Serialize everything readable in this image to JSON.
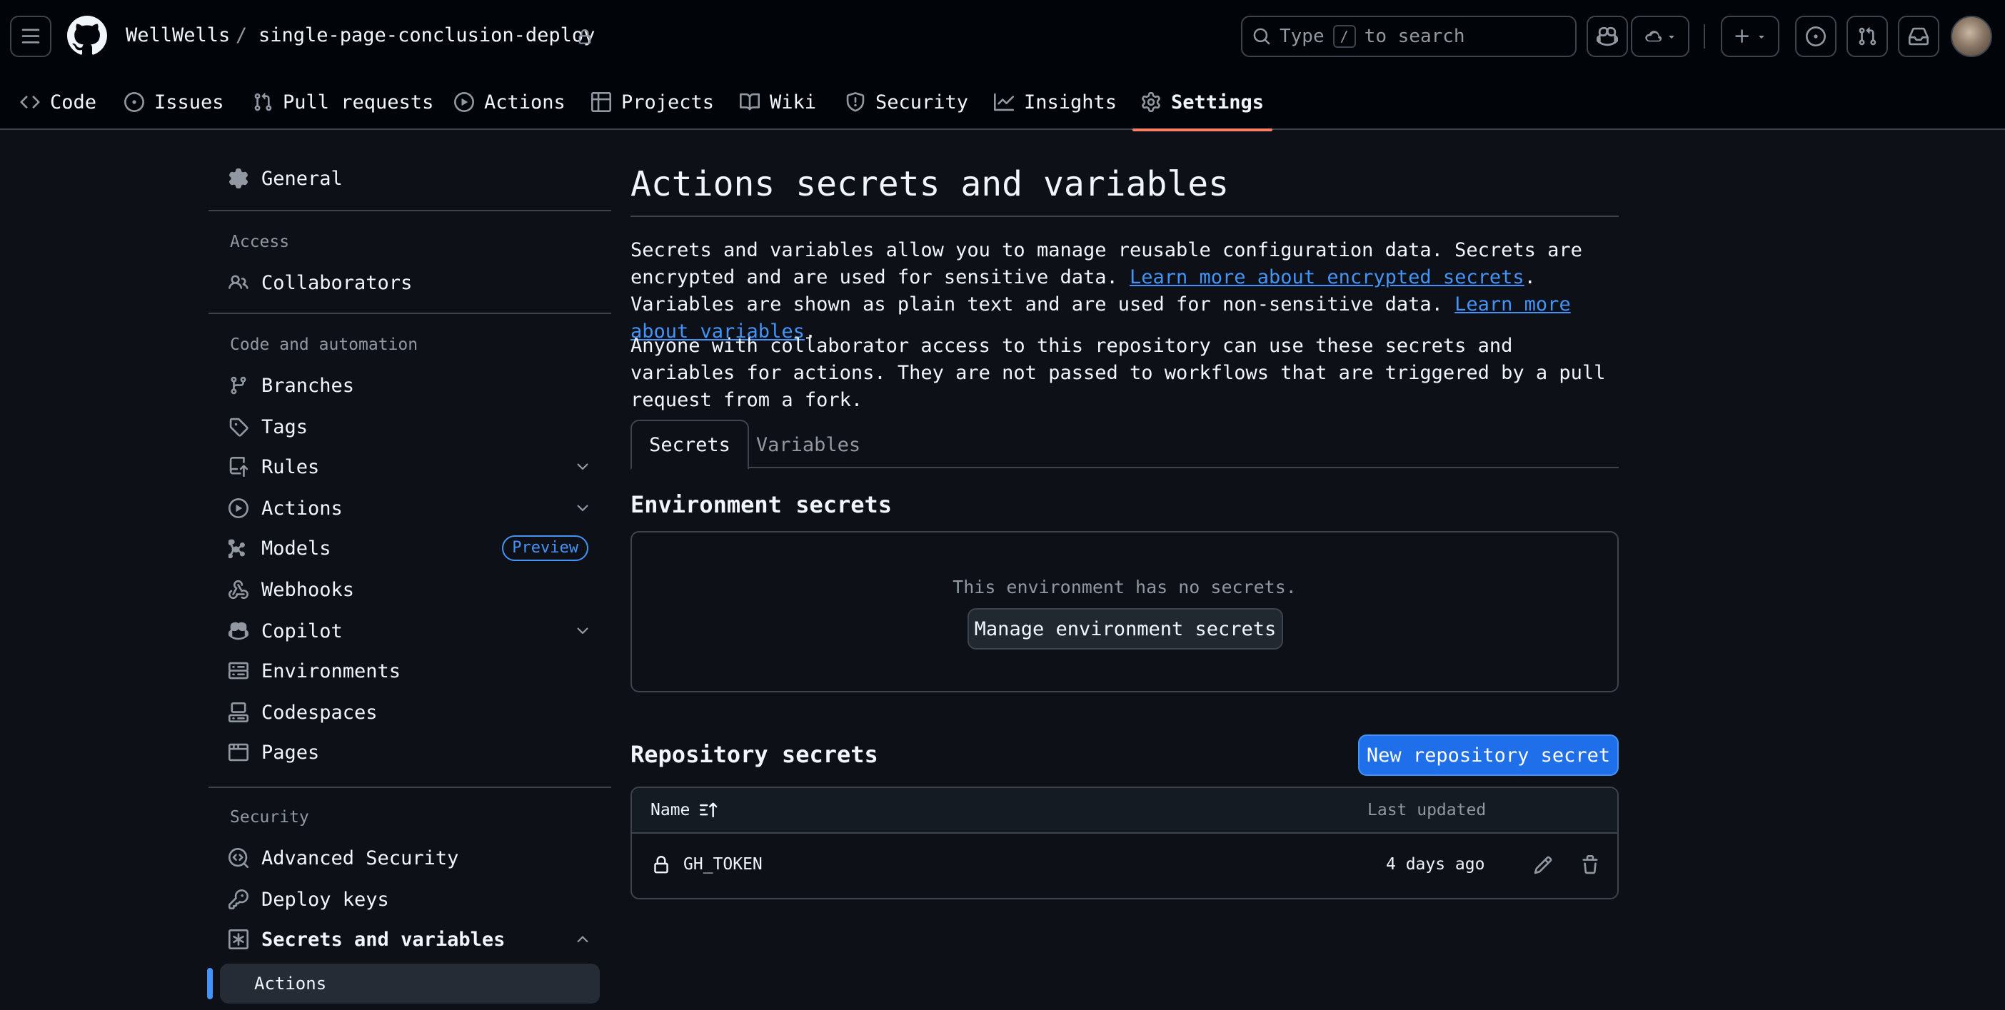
{
  "repo": {
    "owner": "WellWells",
    "separator": "/",
    "name": "single-page-conclusion-deploy"
  },
  "search": {
    "prefix": "Type",
    "key": "/",
    "suffix": "to search"
  },
  "tabs": [
    {
      "label": "Code",
      "icon": "code-icon"
    },
    {
      "label": "Issues",
      "icon": "issue-opened-icon"
    },
    {
      "label": "Pull requests",
      "icon": "git-pull-request-icon"
    },
    {
      "label": "Actions",
      "icon": "play-icon"
    },
    {
      "label": "Projects",
      "icon": "table-icon"
    },
    {
      "label": "Wiki",
      "icon": "book-icon"
    },
    {
      "label": "Security",
      "icon": "shield-icon"
    },
    {
      "label": "Insights",
      "icon": "graph-icon"
    },
    {
      "label": "Settings",
      "icon": "gear-icon",
      "selected": true
    }
  ],
  "sidebar": {
    "general": "General",
    "access_heading": "Access",
    "collaborators": "Collaborators",
    "code_heading": "Code and automation",
    "branches": "Branches",
    "tags": "Tags",
    "rules": "Rules",
    "actions": "Actions",
    "models": "Models",
    "models_badge": "Preview",
    "webhooks": "Webhooks",
    "copilot": "Copilot",
    "environments": "Environments",
    "codespaces": "Codespaces",
    "pages": "Pages",
    "security_heading": "Security",
    "advanced_security": "Advanced Security",
    "deploy_keys": "Deploy keys",
    "secrets_and_variables": "Secrets and variables",
    "secrets_actions": "Actions"
  },
  "main": {
    "title": "Actions secrets and variables",
    "intro_1": "Secrets and variables allow you to manage reusable configuration data. Secrets are encrypted and are used for sensitive data. ",
    "intro_link_1": "Learn more about encrypted secrets",
    "intro_2": ". Variables are shown as plain text and are used for non-sensitive data. ",
    "intro_link_2": "Learn more about variables",
    "intro_3": ".",
    "access_note": "Anyone with collaborator access to this repository can use these secrets and variables for actions. They are not passed to workflows that are triggered by a pull request from a fork.",
    "subtabs": {
      "secrets": "Secrets",
      "variables": "Variables"
    },
    "env_secrets": {
      "title": "Environment secrets",
      "empty": "This environment has no secrets.",
      "manage_button": "Manage environment secrets"
    },
    "repo_secrets": {
      "title": "Repository secrets",
      "new_button": "New repository secret",
      "columns": {
        "name": "Name",
        "updated": "Last updated"
      },
      "rows": [
        {
          "name": "GH_TOKEN",
          "updated": "4 days ago"
        }
      ]
    }
  },
  "colors": {
    "background": "#0d1117",
    "header": "#010409",
    "border": "#3d444d",
    "link": "#4493f8",
    "primary_button": "#1f6feb",
    "selected_tab_underline": "#f78166"
  }
}
